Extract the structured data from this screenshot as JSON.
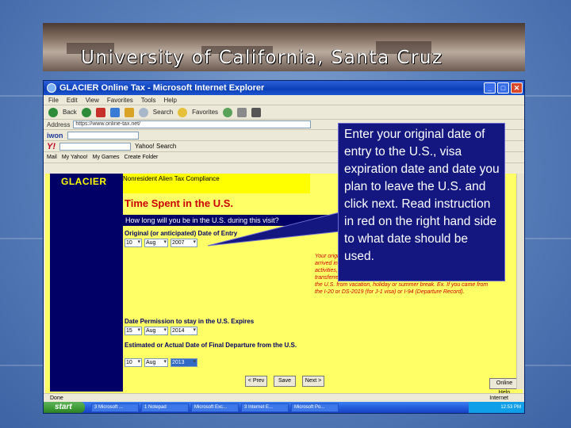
{
  "banner": {
    "title": "University of California, Santa Cruz"
  },
  "browser": {
    "window_title": "GLACIER Online Tax - Microsoft Internet Explorer",
    "menu": [
      "File",
      "Edit",
      "View",
      "Favorites",
      "Tools",
      "Help"
    ],
    "toolbar": {
      "back": "Back",
      "search": "Search",
      "favorites": "Favorites"
    },
    "address_label": "Address",
    "address_value": "https://www.online-tax.net/",
    "iwon_logo": "iwon",
    "yahoo_logo": "Y!",
    "yahoo_search_label": "Yahoo! Search",
    "link_buttons": [
      "Mail",
      "My Yahoo!",
      "My Games",
      "Create Folder"
    ],
    "status_text": "Done",
    "status_zone": "Internet"
  },
  "page": {
    "brand": "GLACIER",
    "header_text": "Nonresident Alien Tax Compliance",
    "section_title": "Time Spent in the U.S.",
    "question": "How long will you be in the U.S. during this visit?",
    "field1": {
      "label": "Original (or anticipated) Date of Entry",
      "day": "10",
      "month": "Aug",
      "year": "2007"
    },
    "field2": {
      "label": "Date Permission to stay in the U.S. Expires",
      "day": "15",
      "month": "Aug",
      "year": "2014"
    },
    "field3": {
      "label": "Estimated or Actual Date of Final Departure from the U.S.",
      "day": "10",
      "month": "Aug",
      "year": "2013"
    },
    "red_instructions": "Your original date of entry to the U.S. for this visit is the date you first arrived in the U.S. to begin your study, teaching, research, or other activities, and regardless of whether you have changed institutions, transferred, received a new visa stamp in your passport, or returned to the U.S. from vacation, holiday or summer break. Ex. If you came from the I-20 or DS-2019 (for J-1 visa) or I-94 (Departure Record).",
    "buttons": {
      "prev": "< Prev",
      "save": "Save",
      "next": "Next >",
      "help": "Online Help"
    }
  },
  "taskbar": {
    "start": "start",
    "items": [
      "3 Microsoft ...",
      "1 Notepad",
      "Microsoft Exc...",
      "3 Internet E...",
      "Microsoft Po..."
    ],
    "clock": "12:53 PM"
  },
  "callout": {
    "text": "Enter your original date of entry to the U.S., visa expiration date and date you plan to leave the U.S. and click next. Read instruction in red on the right hand side to what date should be used."
  }
}
